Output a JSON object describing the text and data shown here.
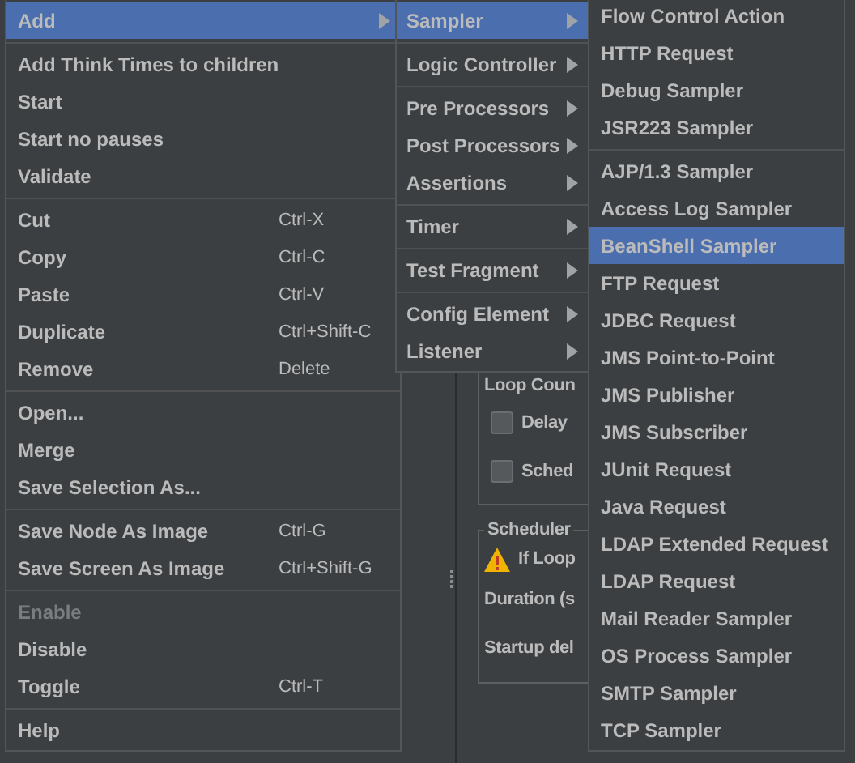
{
  "panel": {
    "loop_label": "Loop Coun",
    "checkboxes": [
      {
        "label": "Delay",
        "checked": false
      },
      {
        "label": "Sched",
        "checked": false
      }
    ],
    "scheduler": {
      "title": "Scheduler",
      "warning": "If Loop",
      "fields": [
        "Duration (s",
        "Startup del"
      ]
    }
  },
  "menus": [
    {
      "items": [
        {
          "kind": "item",
          "label": "Add",
          "submenu": true,
          "selected": true,
          "disabled": false
        },
        {
          "kind": "separator"
        },
        {
          "kind": "item",
          "label": "Add Think Times to children",
          "submenu": false,
          "selected": false,
          "disabled": false
        },
        {
          "kind": "item",
          "label": "Start",
          "submenu": false,
          "selected": false,
          "disabled": false
        },
        {
          "kind": "item",
          "label": "Start no pauses",
          "submenu": false,
          "selected": false,
          "disabled": false
        },
        {
          "kind": "item",
          "label": "Validate",
          "submenu": false,
          "selected": false,
          "disabled": false
        },
        {
          "kind": "separator"
        },
        {
          "kind": "item",
          "label": "Cut",
          "shortcut": "Ctrl-X",
          "submenu": false,
          "selected": false,
          "disabled": false
        },
        {
          "kind": "item",
          "label": "Copy",
          "shortcut": "Ctrl-C",
          "submenu": false,
          "selected": false,
          "disabled": false
        },
        {
          "kind": "item",
          "label": "Paste",
          "shortcut": "Ctrl-V",
          "submenu": false,
          "selected": false,
          "disabled": false
        },
        {
          "kind": "item",
          "label": "Duplicate",
          "shortcut": "Ctrl+Shift-C",
          "submenu": false,
          "selected": false,
          "disabled": false
        },
        {
          "kind": "item",
          "label": "Remove",
          "shortcut": "Delete",
          "submenu": false,
          "selected": false,
          "disabled": false
        },
        {
          "kind": "separator"
        },
        {
          "kind": "item",
          "label": "Open...",
          "submenu": false,
          "selected": false,
          "disabled": false
        },
        {
          "kind": "item",
          "label": "Merge",
          "submenu": false,
          "selected": false,
          "disabled": false
        },
        {
          "kind": "item",
          "label": "Save Selection As...",
          "submenu": false,
          "selected": false,
          "disabled": false
        },
        {
          "kind": "separator"
        },
        {
          "kind": "item",
          "label": "Save Node As Image",
          "shortcut": "Ctrl-G",
          "submenu": false,
          "selected": false,
          "disabled": false
        },
        {
          "kind": "item",
          "label": "Save Screen As Image",
          "shortcut": "Ctrl+Shift-G",
          "submenu": false,
          "selected": false,
          "disabled": false
        },
        {
          "kind": "separator"
        },
        {
          "kind": "item",
          "label": "Enable",
          "submenu": false,
          "selected": false,
          "disabled": true
        },
        {
          "kind": "item",
          "label": "Disable",
          "submenu": false,
          "selected": false,
          "disabled": false
        },
        {
          "kind": "item",
          "label": "Toggle",
          "shortcut": "Ctrl-T",
          "submenu": false,
          "selected": false,
          "disabled": false
        },
        {
          "kind": "separator"
        },
        {
          "kind": "item",
          "label": "Help",
          "submenu": false,
          "selected": false,
          "disabled": false
        }
      ]
    },
    {
      "items": [
        {
          "kind": "item",
          "label": "Sampler",
          "submenu": true,
          "selected": true,
          "disabled": false
        },
        {
          "kind": "separator"
        },
        {
          "kind": "item",
          "label": "Logic Controller",
          "submenu": true,
          "selected": false,
          "disabled": false
        },
        {
          "kind": "separator"
        },
        {
          "kind": "item",
          "label": "Pre Processors",
          "submenu": true,
          "selected": false,
          "disabled": false
        },
        {
          "kind": "item",
          "label": "Post Processors",
          "submenu": true,
          "selected": false,
          "disabled": false
        },
        {
          "kind": "item",
          "label": "Assertions",
          "submenu": true,
          "selected": false,
          "disabled": false
        },
        {
          "kind": "separator"
        },
        {
          "kind": "item",
          "label": "Timer",
          "submenu": true,
          "selected": false,
          "disabled": false
        },
        {
          "kind": "separator"
        },
        {
          "kind": "item",
          "label": "Test Fragment",
          "submenu": true,
          "selected": false,
          "disabled": false
        },
        {
          "kind": "separator"
        },
        {
          "kind": "item",
          "label": "Config Element",
          "submenu": true,
          "selected": false,
          "disabled": false
        },
        {
          "kind": "item",
          "label": "Listener",
          "submenu": true,
          "selected": false,
          "disabled": false
        }
      ]
    },
    {
      "items": [
        {
          "kind": "item",
          "label": "Flow Control Action",
          "submenu": false,
          "selected": false,
          "disabled": false
        },
        {
          "kind": "item",
          "label": "HTTP Request",
          "submenu": false,
          "selected": false,
          "disabled": false
        },
        {
          "kind": "item",
          "label": "Debug Sampler",
          "submenu": false,
          "selected": false,
          "disabled": false
        },
        {
          "kind": "item",
          "label": "JSR223 Sampler",
          "submenu": false,
          "selected": false,
          "disabled": false
        },
        {
          "kind": "separator"
        },
        {
          "kind": "item",
          "label": "AJP/1.3 Sampler",
          "submenu": false,
          "selected": false,
          "disabled": false
        },
        {
          "kind": "item",
          "label": "Access Log Sampler",
          "submenu": false,
          "selected": false,
          "disabled": false
        },
        {
          "kind": "item",
          "label": "BeanShell Sampler",
          "submenu": false,
          "selected": true,
          "disabled": false
        },
        {
          "kind": "item",
          "label": "FTP Request",
          "submenu": false,
          "selected": false,
          "disabled": false
        },
        {
          "kind": "item",
          "label": "JDBC Request",
          "submenu": false,
          "selected": false,
          "disabled": false
        },
        {
          "kind": "item",
          "label": "JMS Point-to-Point",
          "submenu": false,
          "selected": false,
          "disabled": false
        },
        {
          "kind": "item",
          "label": "JMS Publisher",
          "submenu": false,
          "selected": false,
          "disabled": false
        },
        {
          "kind": "item",
          "label": "JMS Subscriber",
          "submenu": false,
          "selected": false,
          "disabled": false
        },
        {
          "kind": "item",
          "label": "JUnit Request",
          "submenu": false,
          "selected": false,
          "disabled": false
        },
        {
          "kind": "item",
          "label": "Java Request",
          "submenu": false,
          "selected": false,
          "disabled": false
        },
        {
          "kind": "item",
          "label": "LDAP Extended Request",
          "submenu": false,
          "selected": false,
          "disabled": false
        },
        {
          "kind": "item",
          "label": "LDAP Request",
          "submenu": false,
          "selected": false,
          "disabled": false
        },
        {
          "kind": "item",
          "label": "Mail Reader Sampler",
          "submenu": false,
          "selected": false,
          "disabled": false
        },
        {
          "kind": "item",
          "label": "OS Process Sampler",
          "submenu": false,
          "selected": false,
          "disabled": false
        },
        {
          "kind": "item",
          "label": "SMTP Sampler",
          "submenu": false,
          "selected": false,
          "disabled": false
        },
        {
          "kind": "item",
          "label": "TCP Sampler",
          "submenu": false,
          "selected": false,
          "disabled": false
        }
      ]
    }
  ]
}
